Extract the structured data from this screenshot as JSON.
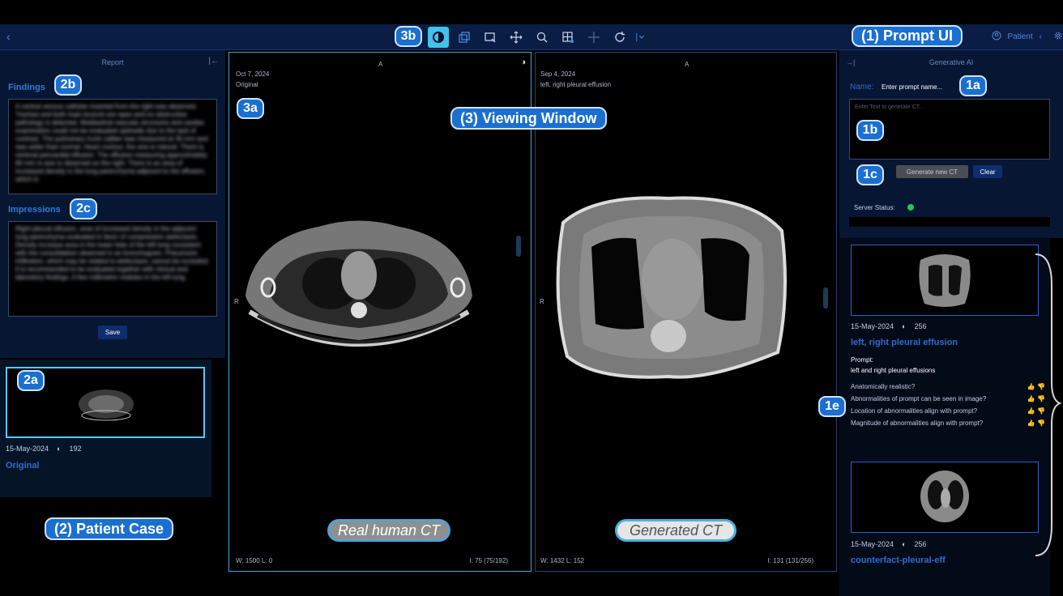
{
  "toolbar": {
    "icons": [
      "contrast-icon",
      "layers-icon",
      "select-box-icon",
      "move-icon",
      "zoom-icon",
      "grid-icon",
      "crosshair-icon",
      "rotate-icon",
      "chevron-down-icon"
    ],
    "patient_label": "Patient"
  },
  "labels": {
    "prompt_ui": "(1) Prompt UI",
    "patient_case": "(2) Patient Case",
    "viewing_window": "(3) Viewing Window",
    "b1a": "1a",
    "b1b": "1b",
    "b1c": "1c",
    "b1e": "1e",
    "b2a": "2a",
    "b2b": "2b",
    "b2c": "2c",
    "b3a": "3a",
    "b3b": "3b"
  },
  "report": {
    "title": "Report",
    "findings_title": "Findings",
    "findings_text": "A central venous catheter inserted from the right was observed. Trachea and both main bronchi are open and no obstructive pathology is detected. Mediastinal vascular structures and cardiac examination could not be evaluated optimally due to the lack of contrast. The pulmonary trunk caliber was measured at 30 mm and was wider than normal. Heart contour, the size is natural. There is minimal pericardial effusion. The effusion measuring approximately 80 mm in size is observed on the right. There is an area of increased density in the lung parenchyma adjacent to the effusion, which is",
    "impressions_title": "Impressions",
    "impressions_text": "Right pleural effusion, area of increased density in the adjacent lung parenchyma evaluated in favor of compression atelectasis. Density increase area in the lower lobe of the left lung consistent with the consolidation observed in an bronchogram. Pneumonic infiltration, which may be related to atelectasis, cannot be excluded. It is recommended to be evaluated together with clinical and laboratory findings. A few millimetric nodules in the left lung.",
    "save_label": "Save"
  },
  "patient_case": {
    "date": "15-May-2024",
    "count": "192",
    "series_name": "Original"
  },
  "viewer": {
    "left": {
      "date": "Oct 7, 2024",
      "series": "Original",
      "orient_top": "A",
      "orient_left": "R",
      "wl": "W: 1500  L: 0",
      "index": "I: 75 (75/192)",
      "caption": "Real human CT"
    },
    "right": {
      "date": "Sep 4, 2024",
      "series": "left, right pleural effusion",
      "orient_top": "A",
      "orient_left": "R",
      "wl": "W: 1432  L: 152",
      "index": "I: 131 (131/256)",
      "caption": "Generated CT"
    }
  },
  "generative": {
    "title": "Generative AI",
    "name_label": "Name:",
    "name_value": "Enter prompt name...",
    "prompt_placeholder": "Enter Text to generate CT...",
    "generate_label": "Generate new CT",
    "clear_label": "Clear",
    "server_status_label": "Server Status:",
    "server_status_color": "#22c55e"
  },
  "generated_items": [
    {
      "date": "15-May-2024",
      "count": "256",
      "name": "left, right pleural effusion",
      "prompt_label": "Prompt:",
      "prompt_text": "left and right pleural effusions",
      "questions": [
        "Anatomically realistic?",
        "Abnormalities of prompt can be seen in image?",
        "Location of abnormalities align with prompt?",
        "Magnitude of abnormalities align with prompt?"
      ]
    },
    {
      "date": "15-May-2024",
      "count": "256",
      "name": "counterfact-pleural-eff"
    }
  ],
  "colors": {
    "accent": "#43c1ea",
    "brand": "#1a6fd0",
    "panel": "#071733",
    "link": "#2f6dd0"
  }
}
